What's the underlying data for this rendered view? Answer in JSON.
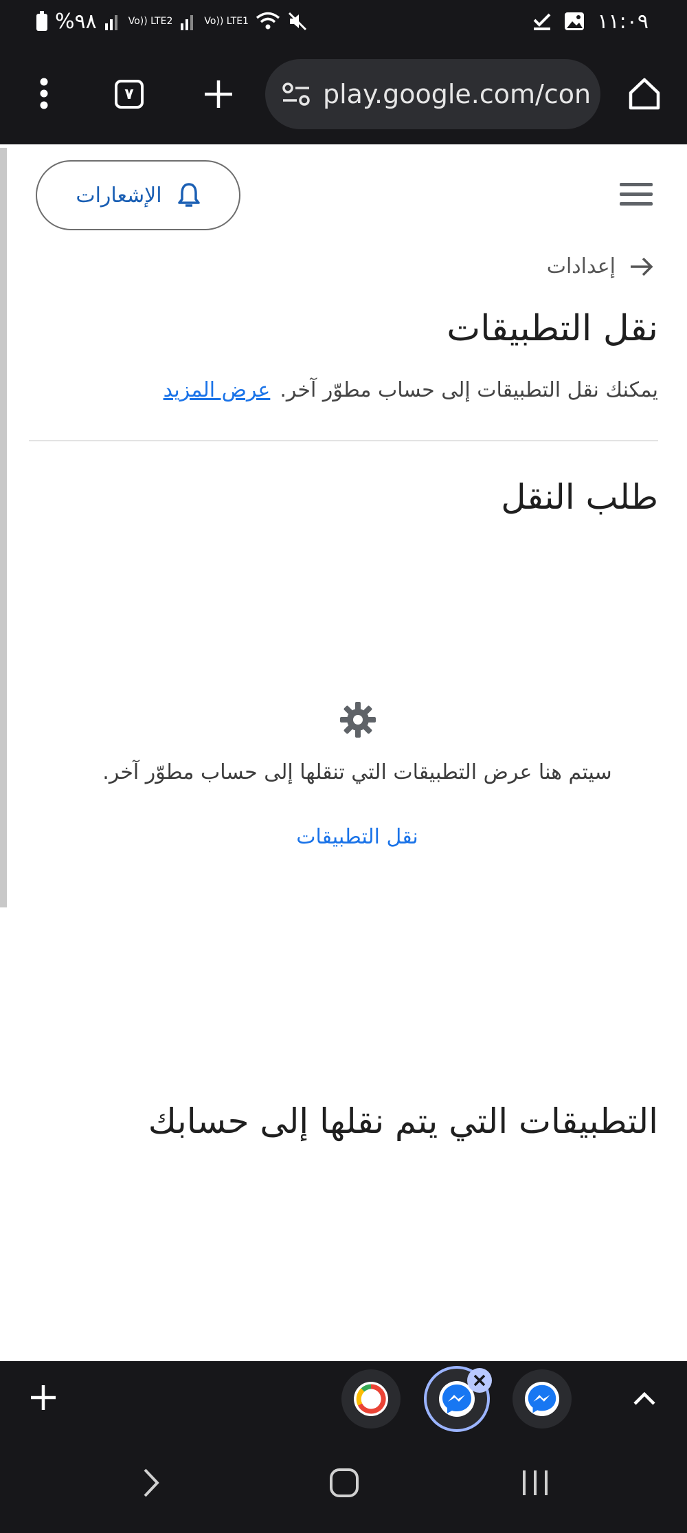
{
  "status_bar": {
    "battery": "%٩٨",
    "sim2_label": "Vo)) LTE2",
    "sim1_label": "Vo)) LTE1",
    "time": "١١:٠٩"
  },
  "toolbar": {
    "tab_count": "٧",
    "url": "play.google.com/con"
  },
  "page": {
    "notifications_label": "الإشعارات",
    "breadcrumb_label": "إعدادات",
    "title": "نقل التطبيقات",
    "description": "يمكنك نقل التطبيقات إلى حساب مطوّر آخر.",
    "learn_more": "عرض المزيد",
    "section_request": "طلب النقل",
    "empty_state_text": "سيتم هنا عرض التطبيقات التي تنقلها إلى حساب مطوّر آخر.",
    "move_apps_link": "نقل التطبيقات",
    "section_incoming": "التطبيقات التي يتم نقلها إلى حسابك"
  },
  "colors": {
    "accent": "#1a73e8",
    "dark_bar": "#17171a"
  }
}
